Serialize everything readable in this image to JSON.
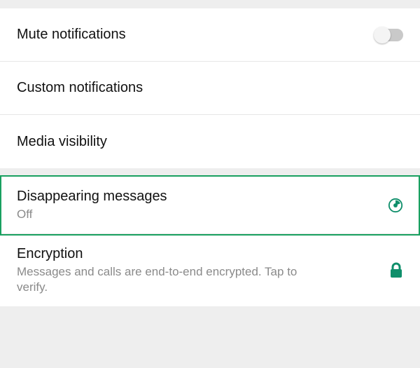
{
  "section1": {
    "mute": {
      "label": "Mute notifications",
      "on": false
    },
    "custom": {
      "label": "Custom notifications"
    },
    "media": {
      "label": "Media visibility"
    }
  },
  "section2": {
    "disappearing": {
      "label": "Disappearing messages",
      "status": "Off"
    },
    "encryption": {
      "label": "Encryption",
      "desc": "Messages and calls are end-to-end encrypted. Tap to verify."
    }
  },
  "colors": {
    "accent": "#0f8f6b"
  }
}
